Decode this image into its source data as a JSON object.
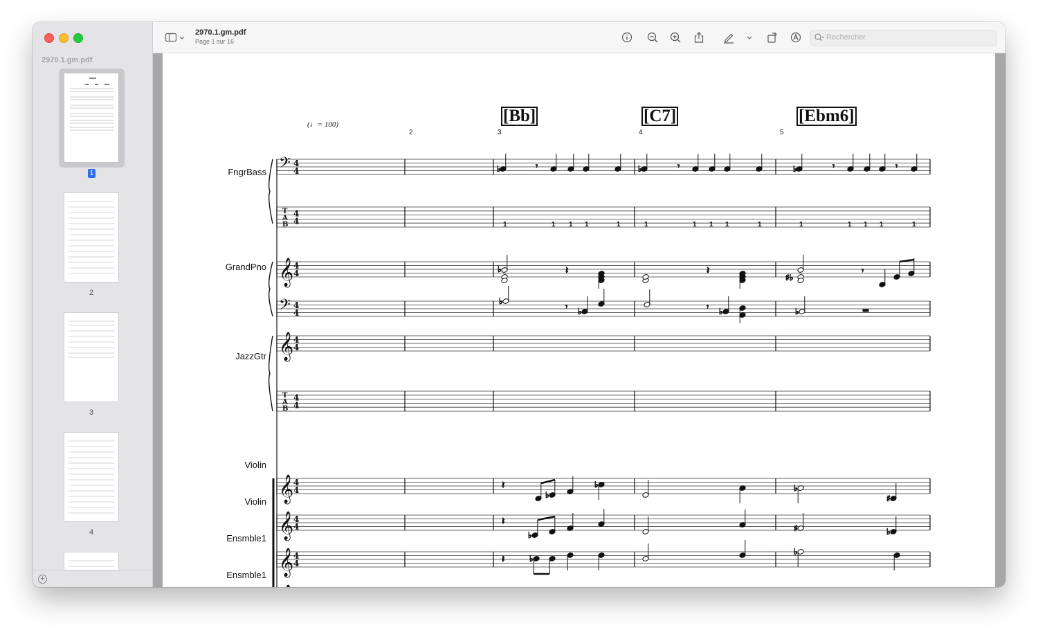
{
  "window": {
    "doc_title": "2970.1.gm.pdf",
    "page_indicator": "Page 1 sur 16",
    "search_placeholder": "Rechercher"
  },
  "sidebar": {
    "title": "2970.1.gm.pdf",
    "thumbnails": [
      {
        "label": "1",
        "selected": true
      },
      {
        "label": "2",
        "selected": false
      },
      {
        "label": "3",
        "selected": false
      },
      {
        "label": "4",
        "selected": false
      },
      {
        "label": "",
        "selected": false
      }
    ]
  },
  "toolbar": {
    "icons": [
      "sidebar-toggle-icon",
      "chevron-down-icon",
      "info-icon",
      "zoom-out-icon",
      "zoom-in-icon",
      "share-icon",
      "markup-pen-icon",
      "chevron-down-icon",
      "rotate-icon",
      "annotate-icon",
      "signature-icon",
      "search-icon"
    ]
  },
  "score": {
    "tempo": "(♩= 100)",
    "measure_numbers": [
      "2",
      "3",
      "4",
      "5"
    ],
    "chords": [
      "[Bb]",
      "[C7]",
      "[Ebm6]"
    ],
    "instruments": [
      "FngrBass",
      "GrandPno",
      "JazzGtr",
      "Violin",
      "Violin",
      "Ensmble1",
      "Ensmble1"
    ],
    "tab_fret": "1"
  },
  "colors": {
    "accent": "#2f6ee8",
    "sidebar_bg": "#e4e4e7",
    "doc_bg": "#a7a7a7"
  }
}
